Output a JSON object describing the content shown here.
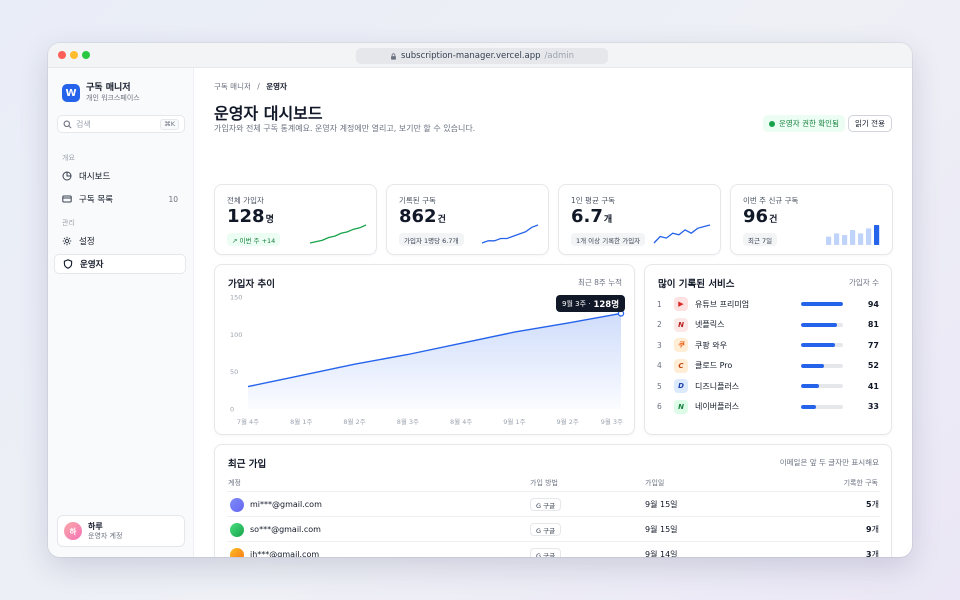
{
  "browser": {
    "url_host": "subscription-manager.vercel.app",
    "url_path": "/admin"
  },
  "brand": {
    "logo": "W",
    "name": "구독 매니저",
    "workspace": "개인 워크스페이스"
  },
  "search": {
    "placeholder": "검색",
    "shortcut": "⌘K"
  },
  "sidebar": {
    "sections": [
      {
        "title": "개요",
        "items": [
          {
            "label": "대시보드",
            "icon": "pie-chart-icon"
          },
          {
            "label": "구독 목록",
            "icon": "card-icon",
            "count": "10"
          }
        ]
      },
      {
        "title": "관리",
        "items": [
          {
            "label": "설정",
            "icon": "gear-icon"
          },
          {
            "label": "운영자",
            "icon": "shield-icon",
            "active": true
          }
        ]
      }
    ]
  },
  "user": {
    "initial": "하",
    "name": "하루",
    "role": "운영자 계정"
  },
  "header": {
    "breadcrumb": [
      "구독 매니저",
      "운영자"
    ],
    "title": "운영자 대시보드",
    "subtitle": "가입자와 전체 구독 통계예요. 운영자 계정에만 열리고, 보기만 할 수 있습니다.",
    "badge": "운영자 권한 확인됨",
    "readonly_button": "읽기 전용"
  },
  "stats": [
    {
      "label": "전체 가입자",
      "value": "128",
      "unit": "명",
      "pill": "↗ 이번 주 +14",
      "pill_style": "green",
      "spark": [
        2,
        3,
        4,
        6,
        7,
        9,
        10,
        12,
        13,
        15
      ]
    },
    {
      "label": "기록된 구독",
      "value": "862",
      "unit": "건",
      "pill": "가입자 1명당 6.7개",
      "spark": [
        1,
        2,
        2,
        3,
        3,
        4,
        5,
        6,
        8,
        9
      ]
    },
    {
      "label": "1인 평균 구독",
      "value": "6.7",
      "unit": "개",
      "pill": "1개 이상 기록한 가입자",
      "spark": [
        5,
        5.4,
        5.3,
        5.6,
        5.5,
        5.8,
        5.6,
        5.9,
        6.0,
        6.1
      ]
    },
    {
      "label": "이번 주 신규 구독",
      "value": "96",
      "unit": "건",
      "pill": "최근 7일",
      "bars": [
        5,
        7,
        6,
        9,
        7,
        10,
        12
      ]
    }
  ],
  "signups_card": {
    "title": "가입자 추이",
    "note": "최근 8주 누적",
    "tooltip_label": "9월 3주 ·",
    "tooltip_value": "128명"
  },
  "chart_data": {
    "type": "area",
    "title": "가입자 추이",
    "categories": [
      "7월 4주",
      "8월 1주",
      "8월 2주",
      "8월 3주",
      "8월 4주",
      "9월 1주",
      "9월 2주",
      "9월 3주"
    ],
    "series": [
      {
        "values": [
          30,
          45,
          60,
          73,
          88,
          103,
          115,
          128
        ]
      }
    ],
    "yticks": [
      0,
      50,
      100,
      150
    ],
    "ylim": [
      0,
      150
    ],
    "grid": false
  },
  "services_card": {
    "title": "많이 기록된 서비스",
    "note": "가입자 수",
    "max": 94,
    "items": [
      {
        "rank": "1",
        "name": "유튜브 프리미엄",
        "value": 94,
        "glyph": "▶",
        "color": "#dc2626",
        "bg": "#fee2e2"
      },
      {
        "rank": "2",
        "name": "넷플릭스",
        "value": 81,
        "glyph": "N",
        "color": "#b91c1c",
        "bg": "#fde8e8"
      },
      {
        "rank": "3",
        "name": "쿠팡 와우",
        "value": 77,
        "glyph": "쿠",
        "color": "#ea580c",
        "bg": "#ffedd5"
      },
      {
        "rank": "4",
        "name": "클로드 Pro",
        "value": 52,
        "glyph": "C",
        "color": "#c2410c",
        "bg": "#ffedd5"
      },
      {
        "rank": "5",
        "name": "디즈니플러스",
        "value": 41,
        "glyph": "D",
        "color": "#1e40af",
        "bg": "#dbeafe"
      },
      {
        "rank": "6",
        "name": "네이버플러스",
        "value": 33,
        "glyph": "N",
        "color": "#15803d",
        "bg": "#dcfce7"
      }
    ]
  },
  "recent_card": {
    "title": "최근 가입",
    "note": "이메일은 앞 두 글자만 표시해요",
    "columns": [
      "계정",
      "가입 방법",
      "가입일",
      "기록한 구독"
    ],
    "rows": [
      {
        "email": "mi***@gmail.com",
        "method": "G 구글",
        "date": "9월 15일",
        "count": "5",
        "unit": "개",
        "avatar": [
          "#818cf8",
          "#6366f1"
        ]
      },
      {
        "email": "so***@gmail.com",
        "method": "G 구글",
        "date": "9월 15일",
        "count": "9",
        "unit": "개",
        "avatar": [
          "#4ade80",
          "#16a34a"
        ]
      },
      {
        "email": "jh***@gmail.com",
        "method": "G 구글",
        "date": "9월 14일",
        "count": "3",
        "unit": "개",
        "avatar": [
          "#fbbf24",
          "#f97316"
        ]
      }
    ]
  },
  "colors": {
    "accent": "#2563eb",
    "success": "#16a34a"
  }
}
